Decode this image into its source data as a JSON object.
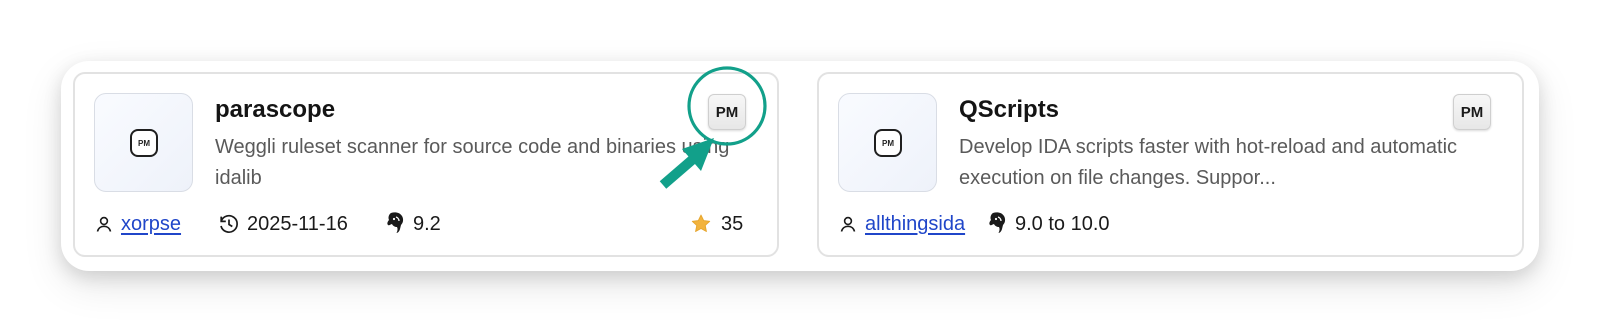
{
  "colors": {
    "annotation": "#12a08a",
    "link": "#2046c9",
    "star": "#f2b33d"
  },
  "cards": [
    {
      "title": "parascope",
      "description": "Weggli ruleset scanner for source code and binaries using idalib",
      "thumb_badge": "PM",
      "corner_badge": "PM",
      "author": "xorpse",
      "date": "2025-11-16",
      "version": "9.2",
      "stars": "35",
      "icons": [
        "user-icon",
        "clock-icon",
        "ida-icon",
        "star-icon"
      ]
    },
    {
      "title": "QScripts",
      "description": "Develop IDA scripts faster with hot-reload and automatic execution on file changes. Suppor...",
      "thumb_badge": "PM",
      "corner_badge": "PM",
      "author": "allthingsida",
      "version": "9.0 to 10.0",
      "icons": [
        "user-icon",
        "ida-icon"
      ]
    }
  ],
  "annotation": {
    "shape": "circle-with-arrow",
    "target": "corner-pm-badge"
  }
}
